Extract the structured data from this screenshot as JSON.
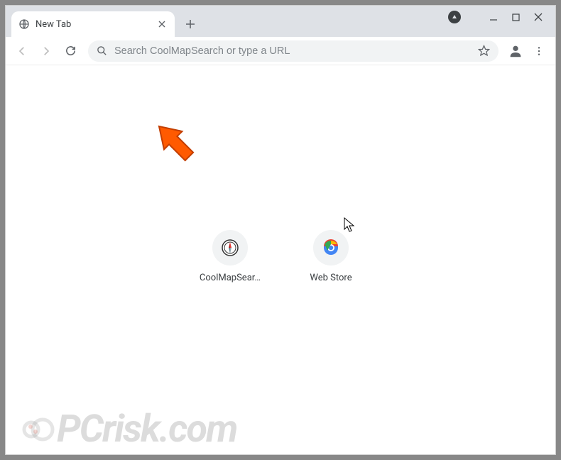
{
  "window": {
    "tab_title": "New Tab"
  },
  "toolbar": {
    "omnibox_placeholder": "Search CoolMapSearch or type a URL"
  },
  "shortcuts": [
    {
      "label": "CoolMapSear…",
      "icon": "compass"
    },
    {
      "label": "Web Store",
      "icon": "chrome"
    }
  ],
  "watermark": {
    "text": "PCrisk.com"
  }
}
